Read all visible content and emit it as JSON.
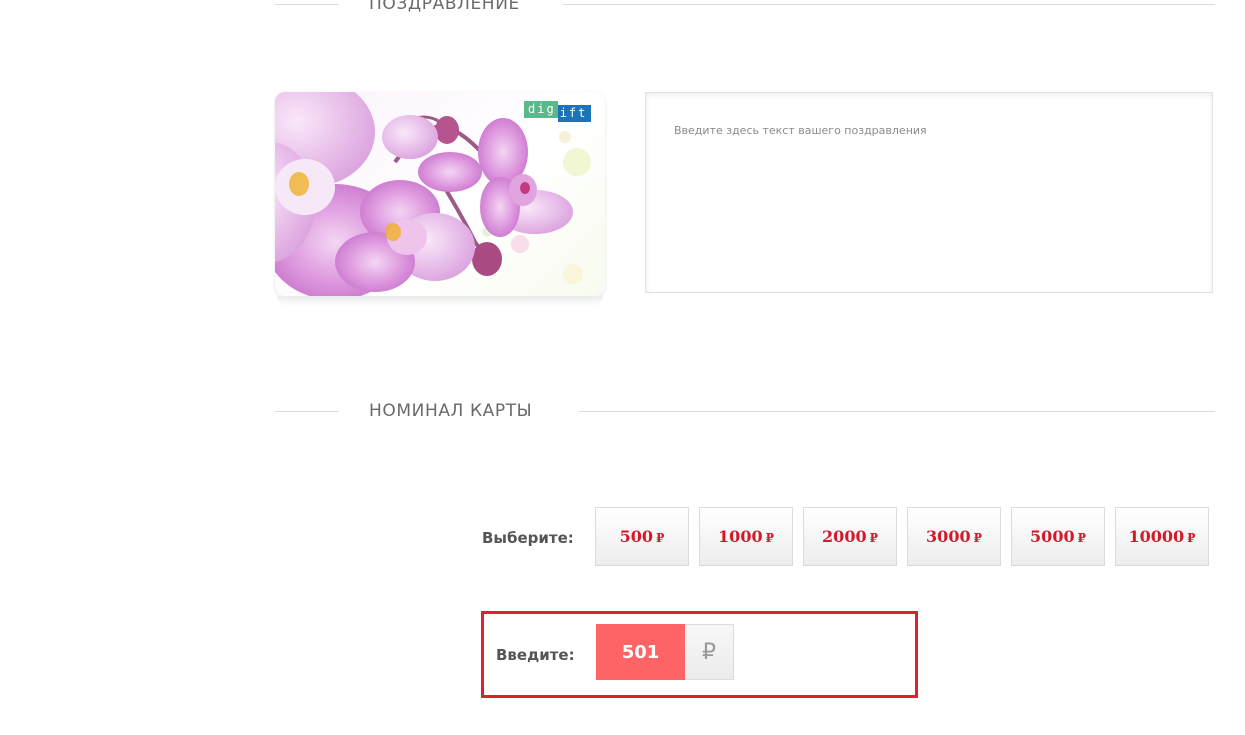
{
  "sections": {
    "greeting_title": "ПОЗДРАВЛЕНИЕ",
    "nominal_title": "НОМИНАЛ КАРТЫ"
  },
  "card": {
    "logo_part1": "dig",
    "logo_part2": "ift",
    "logo_colors": [
      "#5ab88a",
      "#1b73b8"
    ]
  },
  "greeting": {
    "placeholder": "Введите здесь текст вашего поздравления",
    "value": ""
  },
  "nominal": {
    "choose_label": "Выберите:",
    "enter_label": "Введите:",
    "currency_symbol": "₽",
    "denominations": [
      {
        "amount": "500",
        "currency": "₽"
      },
      {
        "amount": "1000",
        "currency": "₽"
      },
      {
        "amount": "2000",
        "currency": "₽"
      },
      {
        "amount": "3000",
        "currency": "₽"
      },
      {
        "amount": "5000",
        "currency": "₽"
      },
      {
        "amount": "10000",
        "currency": "₽"
      }
    ],
    "custom_amount": "501"
  },
  "colors": {
    "accent_red": "#d11a2a",
    "input_fill": "#fe6466",
    "highlight_frame": "#e0202e"
  }
}
